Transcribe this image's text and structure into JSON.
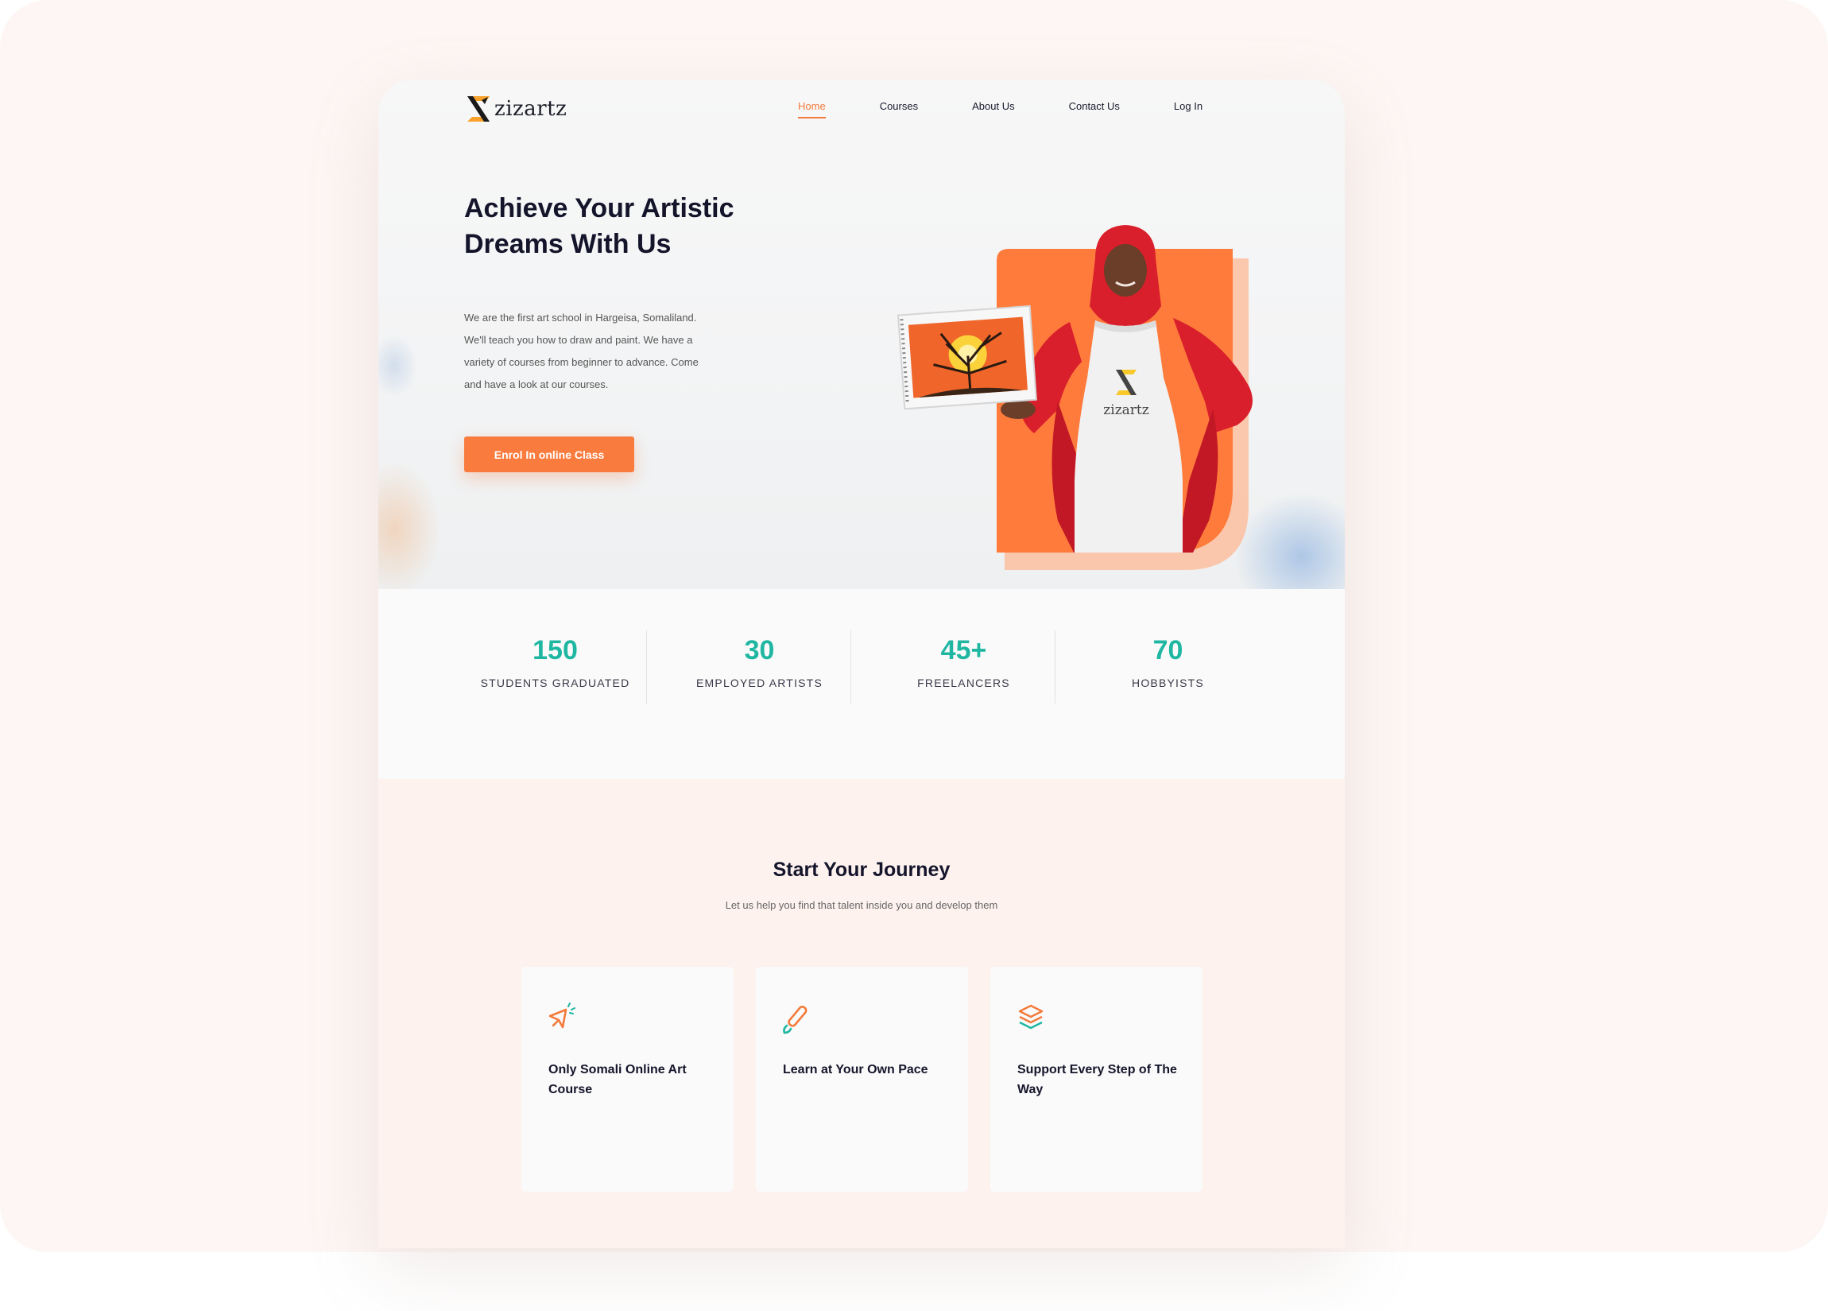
{
  "brand": {
    "name": "zizartz"
  },
  "nav": {
    "items": [
      {
        "label": "Home",
        "active": true
      },
      {
        "label": "Courses",
        "active": false
      },
      {
        "label": "About Us",
        "active": false
      },
      {
        "label": "Contact Us",
        "active": false
      },
      {
        "label": "Log In",
        "active": false
      }
    ]
  },
  "hero": {
    "title": "Achieve Your Artistic Dreams With Us",
    "description": "We are the first art school in Hargeisa, Somaliland. We'll teach you how to draw and paint. We have a variety of courses from beginner to advance. Come and have a look at our courses.",
    "cta_label": "Enrol In online Class",
    "apron_logo_text": "zizartz"
  },
  "stats": [
    {
      "value": "150",
      "label": "STUDENTS GRADUATED"
    },
    {
      "value": "30",
      "label": "EMPLOYED ARTISTS"
    },
    {
      "value": "45+",
      "label": "FREELANCERS"
    },
    {
      "value": "70",
      "label": "HOBBYISTS"
    }
  ],
  "journey": {
    "title": "Start Your Journey",
    "subtitle": "Let us help you find that talent inside you and develop them",
    "features": [
      {
        "title": "Only Somali Online Art Course",
        "icon": "megaphone-icon"
      },
      {
        "title": "Learn at Your Own Pace",
        "icon": "brush-icon"
      },
      {
        "title": "Support Every Step of The Way",
        "icon": "layers-icon"
      }
    ]
  },
  "colors": {
    "accent": "#f97c3e",
    "stat_number": "#1fb7a1",
    "heading": "#14142b",
    "journey_bg": "#fdf2ee"
  }
}
